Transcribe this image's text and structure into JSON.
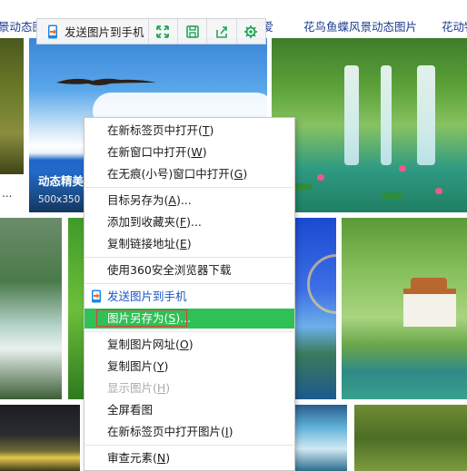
{
  "top_categories": {
    "left": "景动态图",
    "love": "可爱",
    "flower": "花鸟鱼蝶风景动态图片",
    "animal": "花动物"
  },
  "hover_toolbar": {
    "send_label": "发送图片到手机",
    "buttons": [
      "fullscreen-icon",
      "save-icon",
      "share-icon",
      "settings-icon"
    ]
  },
  "featured_tile": {
    "title": "动态精美",
    "size": "500x350"
  },
  "left_tile": {
    "ellipsis": "..."
  },
  "context_menu": {
    "groups": [
      [
        {
          "pre": "在新标签页中打开(",
          "key": "T",
          "post": ")"
        },
        {
          "pre": "在新窗口中打开(",
          "key": "W",
          "post": ")"
        },
        {
          "pre": "在无痕(小号)窗口中打开(",
          "key": "G",
          "post": ")"
        }
      ],
      [
        {
          "pre": "目标另存为(",
          "key": "A",
          "post": ")..."
        },
        {
          "pre": "添加到收藏夹(",
          "key": "F",
          "post": ")..."
        },
        {
          "pre": "复制链接地址(",
          "key": "E",
          "post": ")"
        }
      ],
      [
        {
          "pre": "使用360安全浏览器下载",
          "key": "",
          "post": ""
        }
      ],
      [
        {
          "pre": "发送图片到手机",
          "key": "",
          "post": ""
        },
        {
          "pre": "图片另存为(",
          "key": "S",
          "post": ")..."
        }
      ],
      [
        {
          "pre": "复制图片网址(",
          "key": "O",
          "post": ")"
        },
        {
          "pre": "复制图片(",
          "key": "Y",
          "post": ")"
        },
        {
          "pre": "显示图片(",
          "key": "H",
          "post": ")"
        },
        {
          "pre": "全屏看图",
          "key": "",
          "post": ""
        },
        {
          "pre": "在新标签页中打开图片(",
          "key": "I",
          "post": ")"
        }
      ],
      [
        {
          "pre": "审查元素(",
          "key": "N",
          "post": ")"
        }
      ]
    ],
    "highlighted_item": "图片另存为(S)...",
    "highlight_color": "#2fc156",
    "outline_color": "#e23a3a",
    "disabled_item": "显示图片(H)"
  }
}
